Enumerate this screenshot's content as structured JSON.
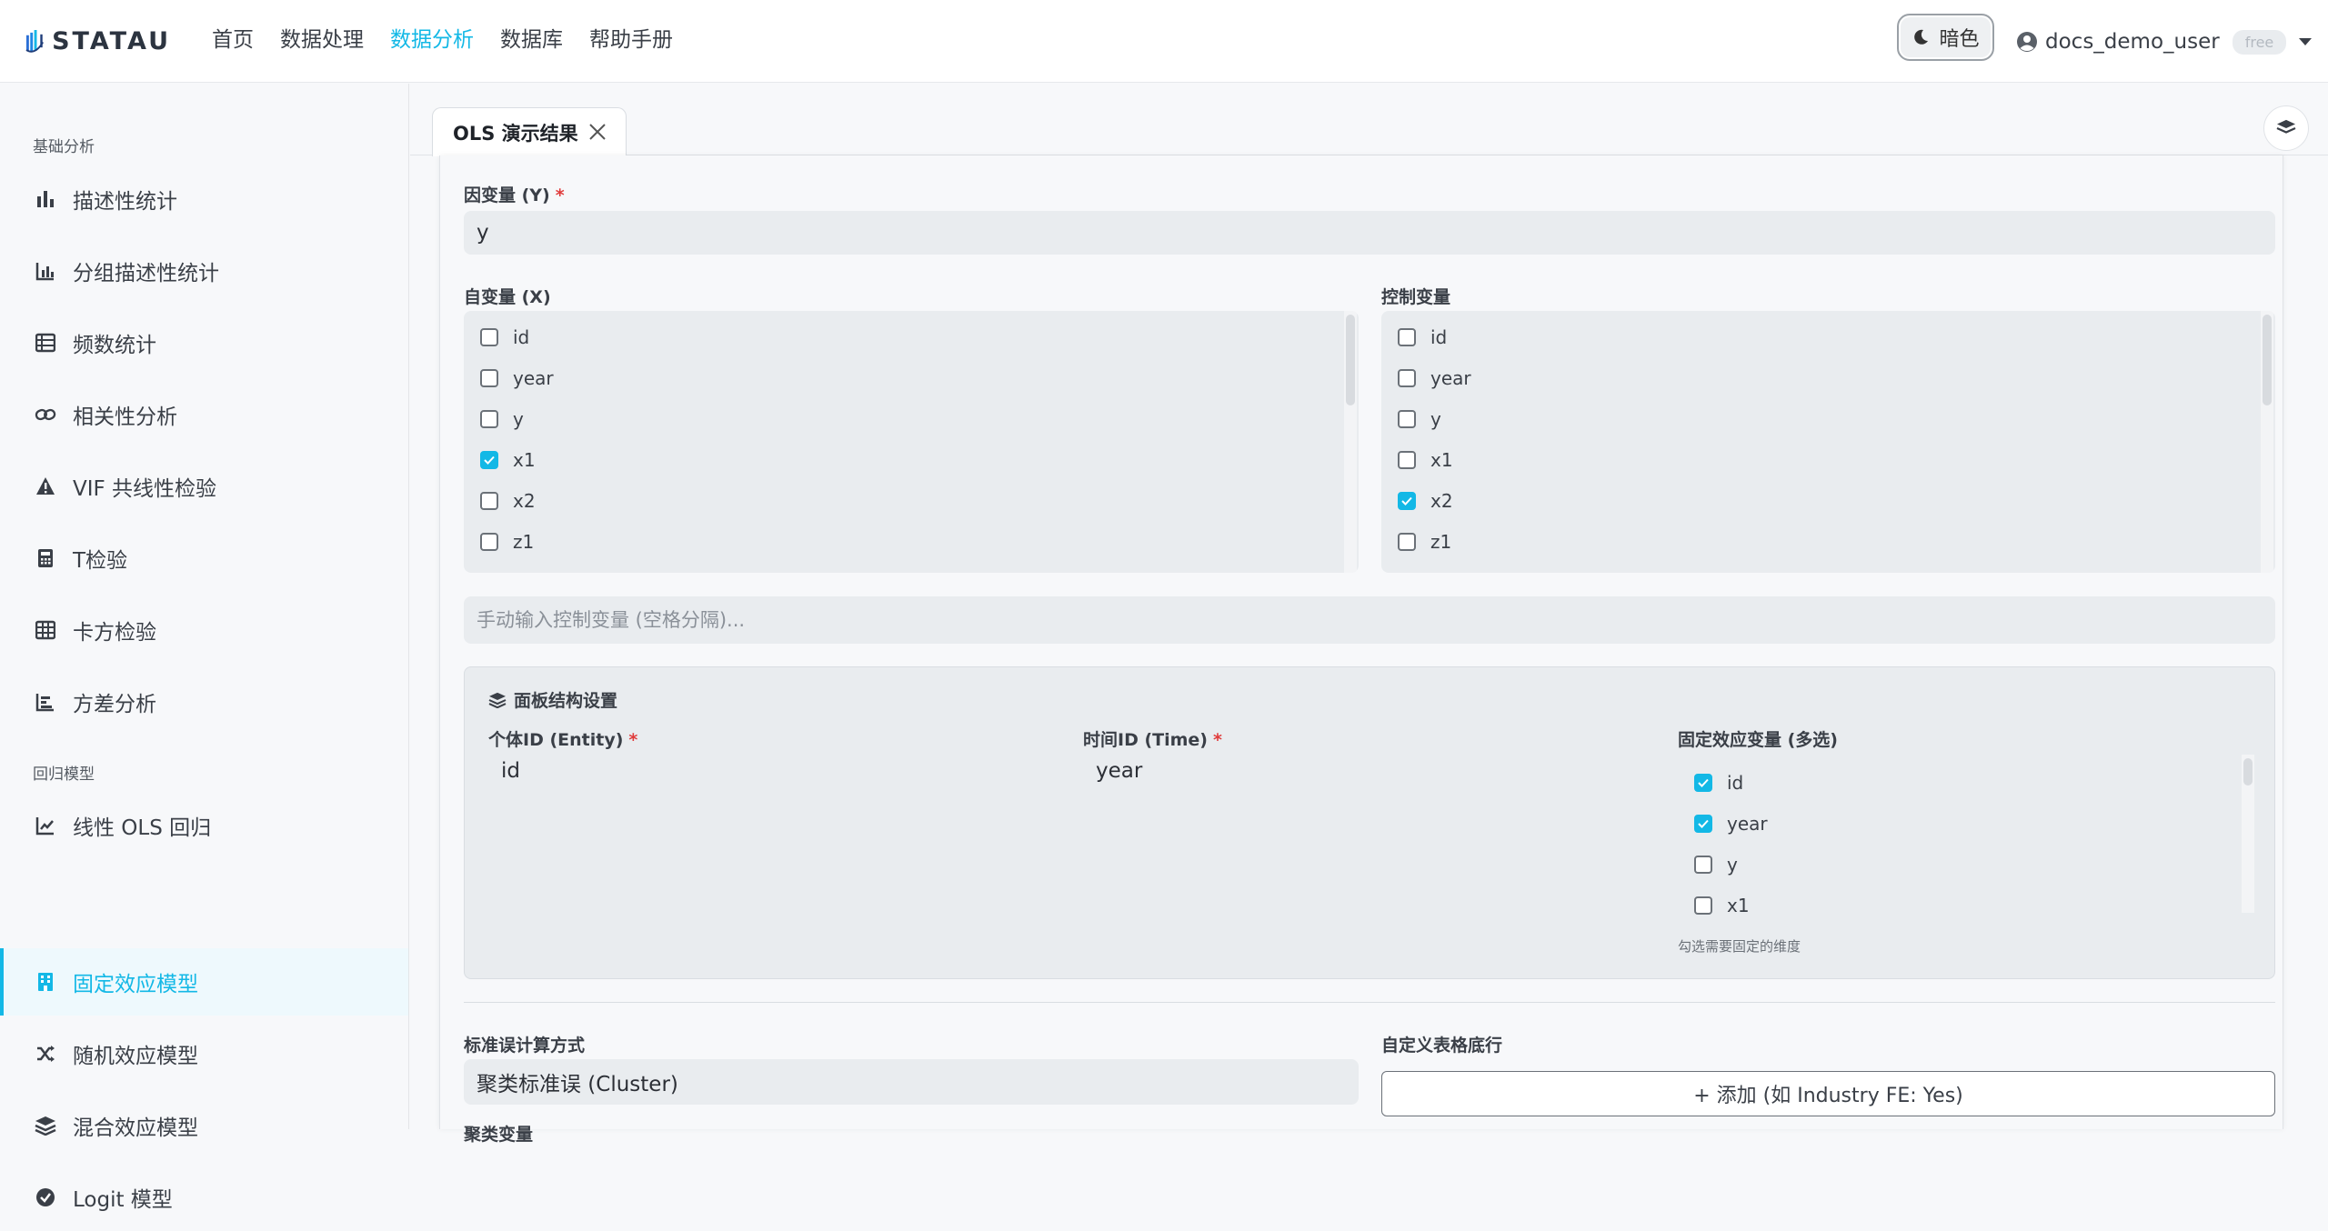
{
  "app": {
    "logo_text": "STATAU"
  },
  "nav": {
    "items": [
      "首页",
      "数据处理",
      "数据分析",
      "数据库",
      "帮助手册"
    ],
    "active_index": 2
  },
  "header": {
    "theme_label": "暗色",
    "username": "docs_demo_user",
    "plan_badge": "free"
  },
  "sidebar": {
    "sections": [
      {
        "title": "基础分析",
        "items": [
          {
            "label": "描述性统计",
            "icon": "bar-chart-icon"
          },
          {
            "label": "分组描述性统计",
            "icon": "grouped-chart-icon"
          },
          {
            "label": "频数统计",
            "icon": "table-list-icon"
          },
          {
            "label": "相关性分析",
            "icon": "link-icon"
          },
          {
            "label": "VIF 共线性检验",
            "icon": "warning-icon"
          },
          {
            "label": "T检验",
            "icon": "calculator-icon"
          },
          {
            "label": "卡方检验",
            "icon": "grid-icon"
          },
          {
            "label": "方差分析",
            "icon": "bar-chart-horizontal-icon"
          }
        ]
      },
      {
        "title": "回归模型",
        "items": [
          {
            "label": "线性 OLS 回归",
            "icon": "line-chart-icon"
          },
          {
            "label": "固定效应模型",
            "icon": "building-icon"
          },
          {
            "label": "随机效应模型",
            "icon": "shuffle-icon"
          },
          {
            "label": "混合效应模型",
            "icon": "layers-icon"
          },
          {
            "label": "Logit 模型",
            "icon": "check-circle-icon"
          }
        ]
      }
    ],
    "active_label": "固定效应模型"
  },
  "tabs": [
    {
      "label": "OLS 演示结果"
    }
  ],
  "form": {
    "dependent": {
      "label": "因变量 (Y)",
      "value": "y"
    },
    "independent": {
      "label": "自变量 (X)",
      "options": [
        "id",
        "year",
        "y",
        "x1",
        "x2",
        "z1"
      ],
      "checked": [
        "x1"
      ]
    },
    "controls": {
      "label": "控制变量",
      "options": [
        "id",
        "year",
        "y",
        "x1",
        "x2",
        "z1"
      ],
      "checked": [
        "x2"
      ]
    },
    "manual_controls": {
      "placeholder": "手动输入控制变量 (空格分隔)..."
    },
    "panel": {
      "title": "面板结构设置",
      "entity": {
        "label": "个体ID (Entity)",
        "value": "id"
      },
      "time": {
        "label": "时间ID (Time)",
        "value": "year"
      },
      "fixed_effects": {
        "label": "固定效应变量 (多选)",
        "options": [
          "id",
          "year",
          "y",
          "x1"
        ],
        "checked": [
          "id",
          "year"
        ],
        "hint": "勾选需要固定的维度"
      }
    },
    "se": {
      "label": "标准误计算方式",
      "value": "聚类标准误 (Cluster)"
    },
    "footer_rows": {
      "label": "自定义表格底行",
      "add_label": "+ 添加 (如 Industry FE: Yes)"
    },
    "cluster_var": {
      "label": "聚类变量"
    }
  },
  "colors": {
    "accent": "#13b8e6",
    "required": "#e03b3b"
  }
}
